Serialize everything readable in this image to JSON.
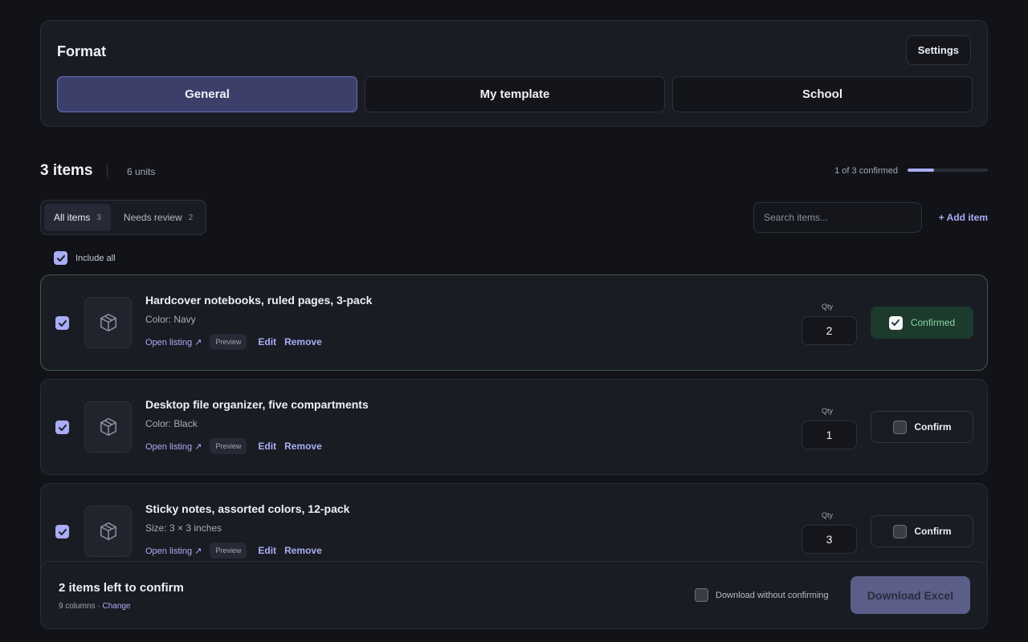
{
  "format": {
    "title": "Format",
    "settings_label": "Settings",
    "templates": [
      {
        "label": "General",
        "active": true
      },
      {
        "label": "My template",
        "active": false
      },
      {
        "label": "School",
        "active": false
      }
    ]
  },
  "summary": {
    "count": "3 items",
    "units": "6 units",
    "confirmed_text": "1 of 3 confirmed",
    "progress_fraction": 0.33
  },
  "filters": {
    "all": {
      "label": "All items",
      "count": "3"
    },
    "review": {
      "label": "Needs review",
      "count": "2"
    }
  },
  "search": {
    "placeholder": "Search items..."
  },
  "add_item_label": "+ Add item",
  "include_all_label": "Include all",
  "items": [
    {
      "title": "Hardcover notebooks, ruled pages, 3-pack",
      "attr": "Color: Navy",
      "open_label": "Open listing ↗",
      "preview_label": "Preview",
      "edit_label": "Edit",
      "remove_label": "Remove",
      "qty_label": "Qty",
      "qty": "2",
      "confirm_label": "Confirmed",
      "confirmed": true
    },
    {
      "title": "Desktop file organizer, five compartments",
      "attr": "Color: Black",
      "open_label": "Open listing ↗",
      "preview_label": "Preview",
      "edit_label": "Edit",
      "remove_label": "Remove",
      "qty_label": "Qty",
      "qty": "1",
      "confirm_label": "Confirm",
      "confirmed": false
    },
    {
      "title": "Sticky notes, assorted colors, 12-pack",
      "attr": "Size: 3 × 3 inches",
      "open_label": "Open listing ↗",
      "preview_label": "Preview",
      "edit_label": "Edit",
      "remove_label": "Remove",
      "qty_label": "Qty",
      "qty": "3",
      "confirm_label": "Confirm",
      "confirmed": false
    }
  ],
  "bottom": {
    "left_msg": "2 items left to confirm",
    "cols_text": "9 columns · ",
    "change_label": "Change",
    "download_without_label": "Download without confirming",
    "download_label": "Download Excel"
  },
  "colors": {
    "accent": "#a9adf5",
    "active_template": "#3b3f6a",
    "confirmed_bg": "#1d3b2c",
    "confirmed_text": "#8ad6a4",
    "download_button": "#5b5e88"
  },
  "icons": {
    "check": "check-icon",
    "box": "package-box-icon"
  }
}
